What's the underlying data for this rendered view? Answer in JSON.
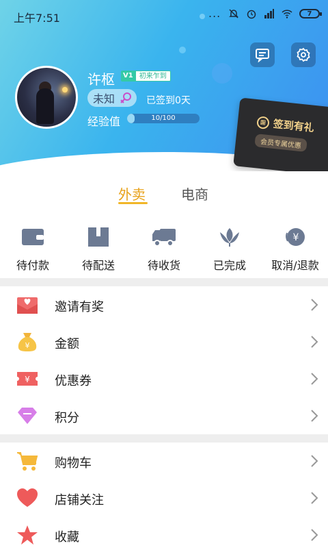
{
  "status_bar": {
    "time": "上午7:51",
    "dots": "...",
    "battery": "7"
  },
  "profile": {
    "name": "许枢",
    "vip_level": "V1",
    "vip_title": "初来乍到",
    "gender_text": "未知",
    "signed_text": "已签到0天",
    "exp_label": "经验值",
    "exp_text": "10/100",
    "exp_progress": 0.1
  },
  "sign_card": {
    "title": "签到有礼",
    "subtitle": "会员专属优惠"
  },
  "tabs": [
    {
      "label": "外卖",
      "active": true
    },
    {
      "label": "电商",
      "active": false
    }
  ],
  "orders": [
    {
      "label": "待付款",
      "icon": "wallet-icon"
    },
    {
      "label": "待配送",
      "icon": "box-icon"
    },
    {
      "label": "待收货",
      "icon": "truck-icon"
    },
    {
      "label": "已完成",
      "icon": "lotus-icon"
    },
    {
      "label": "取消/退款",
      "icon": "refund-icon"
    }
  ],
  "menu_group1": [
    {
      "label": "邀请有奖",
      "icon": "invite-envelope-icon"
    },
    {
      "label": "金额",
      "icon": "money-bag-icon"
    },
    {
      "label": "优惠券",
      "icon": "coupon-icon"
    },
    {
      "label": "积分",
      "icon": "diamond-icon"
    }
  ],
  "menu_group2": [
    {
      "label": "购物车",
      "icon": "cart-icon"
    },
    {
      "label": "店铺关注",
      "icon": "heart-icon"
    },
    {
      "label": "收藏",
      "icon": "star-icon"
    }
  ],
  "colors": {
    "accent": "#f1b628",
    "tab_active": "#e8a21a",
    "header_start": "#6fd3e8",
    "header_end": "#3d8ff0",
    "vip_green": "#35c9a6"
  }
}
